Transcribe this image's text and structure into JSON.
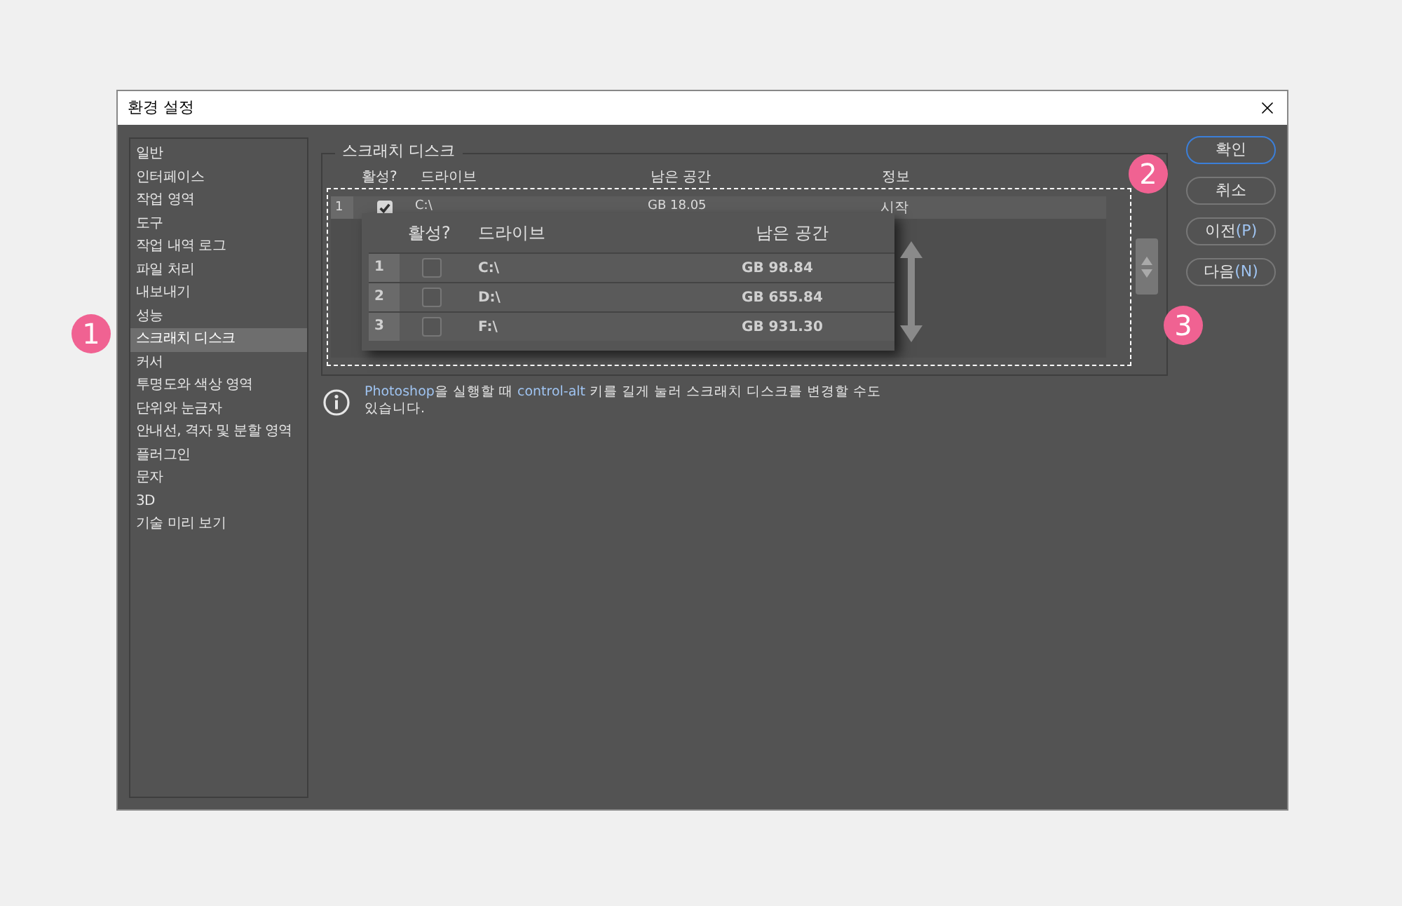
{
  "window": {
    "title": "환경 설정"
  },
  "sidebar": {
    "items": [
      {
        "label": "일반",
        "selected": false
      },
      {
        "label": "인터페이스",
        "selected": false
      },
      {
        "label": "작업 영역",
        "selected": false
      },
      {
        "label": "도구",
        "selected": false
      },
      {
        "label": "작업 내역 로그",
        "selected": false
      },
      {
        "label": "파일 처리",
        "selected": false
      },
      {
        "label": "내보내기",
        "selected": false
      },
      {
        "label": "성능",
        "selected": false
      },
      {
        "label": "스크래치 디스크",
        "selected": true
      },
      {
        "label": "커서",
        "selected": false
      },
      {
        "label": "투명도와 색상 영역",
        "selected": false
      },
      {
        "label": "단위와 눈금자",
        "selected": false
      },
      {
        "label": "안내선, 격자 및 분할 영역",
        "selected": false
      },
      {
        "label": "플러그인",
        "selected": false
      },
      {
        "label": "문자",
        "selected": false
      },
      {
        "label": "3D",
        "selected": false
      },
      {
        "label": "기술 미리 보기",
        "selected": false
      }
    ]
  },
  "scratch_disks": {
    "title": "스크래치 디스크",
    "columns": [
      "활성?",
      "드라이브",
      "남은 공간",
      "정보"
    ],
    "rows": [
      {
        "index": "1",
        "checked": true,
        "drive": "C:\\",
        "free": "GB 18.05",
        "info": "시작"
      }
    ]
  },
  "inset": {
    "columns": [
      "활성?",
      "드라이브",
      "남은 공간"
    ],
    "rows": [
      {
        "index": "1",
        "checked": false,
        "drive": "C:\\",
        "free": "GB 98.84"
      },
      {
        "index": "2",
        "checked": false,
        "drive": "D:\\",
        "free": "GB 655.84"
      },
      {
        "index": "3",
        "checked": false,
        "drive": "F:\\",
        "free": "GB 931.30"
      }
    ]
  },
  "note": [
    {
      "text": "Photoshop",
      "highlight": true
    },
    {
      "text": "을 실행할 때 ",
      "highlight": false
    },
    {
      "text": "control-alt",
      "highlight": true
    },
    {
      "text": " 키를 길게 눌러 스크래치 디스크를 변경할 수도 있습니다.",
      "highlight": false
    }
  ],
  "buttons": [
    {
      "label": "확인",
      "default": true
    },
    {
      "label": "취소",
      "default": false
    },
    {
      "label": "이전",
      "shortcut": "(P)",
      "default": false
    },
    {
      "label": "다음",
      "shortcut": "(N)",
      "default": false
    }
  ],
  "callouts": [
    "1",
    "2",
    "3"
  ]
}
